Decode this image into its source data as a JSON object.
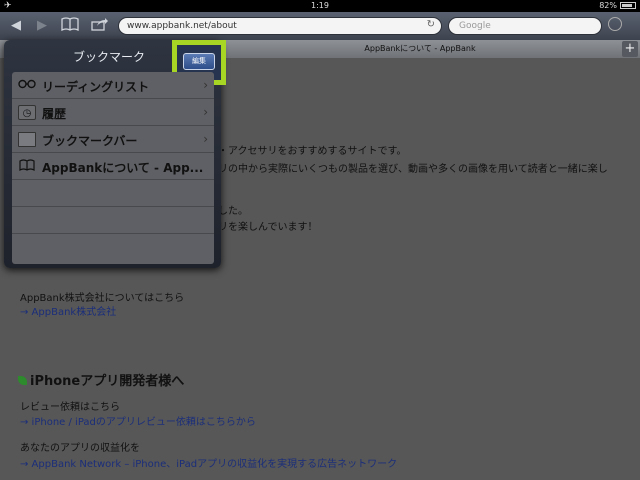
{
  "status": {
    "time": "1:19",
    "battery": "82%",
    "battery_level": 0.82
  },
  "toolbar": {
    "url": "www.appbank.net/about",
    "search_placeholder": "Google"
  },
  "tab": {
    "title": "AppBankについて - AppBank",
    "add": "+"
  },
  "popover": {
    "title": "ブックマーク",
    "edit_label": "編集",
    "items": [
      {
        "icon": "reading-glasses-icon",
        "label": "リーディングリスト",
        "has_chevron": true
      },
      {
        "icon": "history-clock-icon",
        "label": "履歴",
        "has_chevron": true
      },
      {
        "icon": "folder-icon",
        "label": "ブックマークバー",
        "has_chevron": true
      },
      {
        "icon": "book-icon",
        "label": "AppBankについて - App...",
        "has_chevron": false
      }
    ]
  },
  "page": {
    "line1": "リ・アクセサリをおすすめするサイトです。",
    "line2": "サリの中から実際にいくつもの製品を選び、動画や多くの画像を用いて読者と一緒に楽し",
    "line3": "ました。",
    "line4": "プリを楽しんでいます！",
    "company_text": "AppBank株式会社についてはこちら",
    "company_link": "→ AppBank株式会社",
    "dev_heading": "iPhoneアプリ開発者様へ",
    "review_text": "レビュー依頼はこちら",
    "review_link": "→ iPhone / iPadのアプリレビュー依頼はこちらから",
    "monetize_text": "あなたのアプリの収益化を",
    "monetize_link": "→ AppBank Network – iPhone、iPadアプリの収益化を実現する広告ネットワーク"
  }
}
